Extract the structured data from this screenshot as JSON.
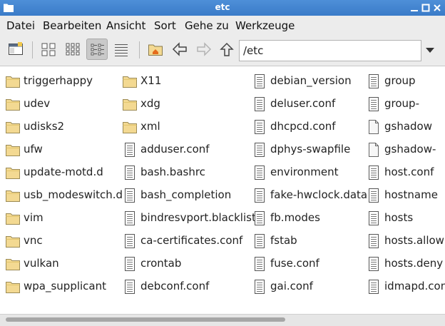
{
  "window": {
    "title": "etc"
  },
  "menu": [
    "Datei",
    "Bearbeiten",
    "Ansicht",
    "Sort",
    "Gehe zu",
    "Werkzeuge"
  ],
  "toolbar": {
    "buttons": [
      "new-tab-icon",
      "icon-view-icon",
      "thumbnail-view-icon",
      "compact-view-icon",
      "detailed-list-icon",
      "home-icon",
      "back-icon",
      "forward-icon",
      "up-icon"
    ],
    "active_view": "compact-view-icon"
  },
  "path": {
    "value": "/etc"
  },
  "columns": [
    [
      {
        "name": "triggerhappy",
        "type": "folder"
      },
      {
        "name": "udev",
        "type": "folder"
      },
      {
        "name": "udisks2",
        "type": "folder"
      },
      {
        "name": "ufw",
        "type": "folder"
      },
      {
        "name": "update-motd.d",
        "type": "folder"
      },
      {
        "name": "usb_modeswitch.d",
        "type": "folder"
      },
      {
        "name": "vim",
        "type": "folder"
      },
      {
        "name": "vnc",
        "type": "folder"
      },
      {
        "name": "vulkan",
        "type": "folder"
      },
      {
        "name": "wpa_supplicant",
        "type": "folder"
      }
    ],
    [
      {
        "name": "X11",
        "type": "folder"
      },
      {
        "name": "xdg",
        "type": "folder"
      },
      {
        "name": "xml",
        "type": "folder"
      },
      {
        "name": "adduser.conf",
        "type": "text"
      },
      {
        "name": "bash.bashrc",
        "type": "text"
      },
      {
        "name": "bash_completion",
        "type": "text"
      },
      {
        "name": "bindresvport.blacklist",
        "type": "text"
      },
      {
        "name": "ca-certificates.conf",
        "type": "text"
      },
      {
        "name": "crontab",
        "type": "text"
      },
      {
        "name": "debconf.conf",
        "type": "text"
      }
    ],
    [
      {
        "name": "debian_version",
        "type": "text"
      },
      {
        "name": "deluser.conf",
        "type": "text"
      },
      {
        "name": "dhcpcd.conf",
        "type": "text"
      },
      {
        "name": "dphys-swapfile",
        "type": "text"
      },
      {
        "name": "environment",
        "type": "text"
      },
      {
        "name": "fake-hwclock.data",
        "type": "text"
      },
      {
        "name": "fb.modes",
        "type": "text"
      },
      {
        "name": "fstab",
        "type": "text"
      },
      {
        "name": "fuse.conf",
        "type": "text"
      },
      {
        "name": "gai.conf",
        "type": "text"
      }
    ],
    [
      {
        "name": "group",
        "type": "text"
      },
      {
        "name": "group-",
        "type": "text"
      },
      {
        "name": "gshadow",
        "type": "blank"
      },
      {
        "name": "gshadow-",
        "type": "blank"
      },
      {
        "name": "host.conf",
        "type": "text"
      },
      {
        "name": "hostname",
        "type": "text"
      },
      {
        "name": "hosts",
        "type": "text"
      },
      {
        "name": "hosts.allow",
        "type": "text"
      },
      {
        "name": "hosts.deny",
        "type": "text"
      },
      {
        "name": "idmapd.conf",
        "type": "text"
      }
    ]
  ],
  "colors": {
    "titlebar": "#3a7bc8",
    "folder": "#f3d992",
    "selection_toolbar": "#c9c9c9"
  }
}
